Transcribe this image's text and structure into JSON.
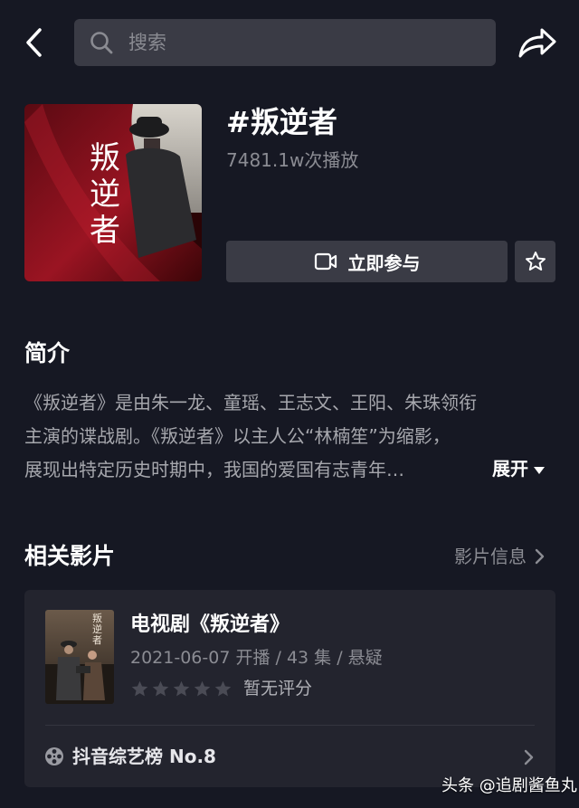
{
  "colors": {
    "background": "#161823",
    "surface": "#3a3b45",
    "card": "#23242e",
    "muted_text": "#8b8c93",
    "poster_red": "#8e1420"
  },
  "header": {
    "back_icon": "chevron-left-icon",
    "search_icon": "search-icon",
    "search_placeholder": "搜索",
    "share_icon": "share-icon"
  },
  "topic": {
    "poster_text": [
      "叛",
      "逆",
      "者"
    ],
    "title": "#叛逆者",
    "plays": "7481.1w次播放",
    "join_label": "立即参与",
    "join_icon": "video-camera-icon",
    "favorite_icon": "star-outline-icon"
  },
  "intro": {
    "title": "简介",
    "lines": [
      "《叛逆者》是由朱一龙、童瑶、王志文、王阳、朱珠领衔",
      "主演的谍战剧。《叛逆者》以主人公“林楠笙”为缩影，",
      "展现出特定历史时期中，我国的爱国有志青年…"
    ],
    "expand_label": "展开"
  },
  "related": {
    "title": "相关影片",
    "info_link": "影片信息",
    "item": {
      "poster_text": "叛逆者",
      "title": "电视剧《叛逆者》",
      "meta": "2021-06-07 开播 / 43 集 / 悬疑",
      "stars_total": 5,
      "rating_text": "暂无评分",
      "rank_icon": "film-reel-icon",
      "rank_text": "抖音综艺榜 No.8"
    }
  },
  "watermark": "头条 @追剧酱鱼丸"
}
